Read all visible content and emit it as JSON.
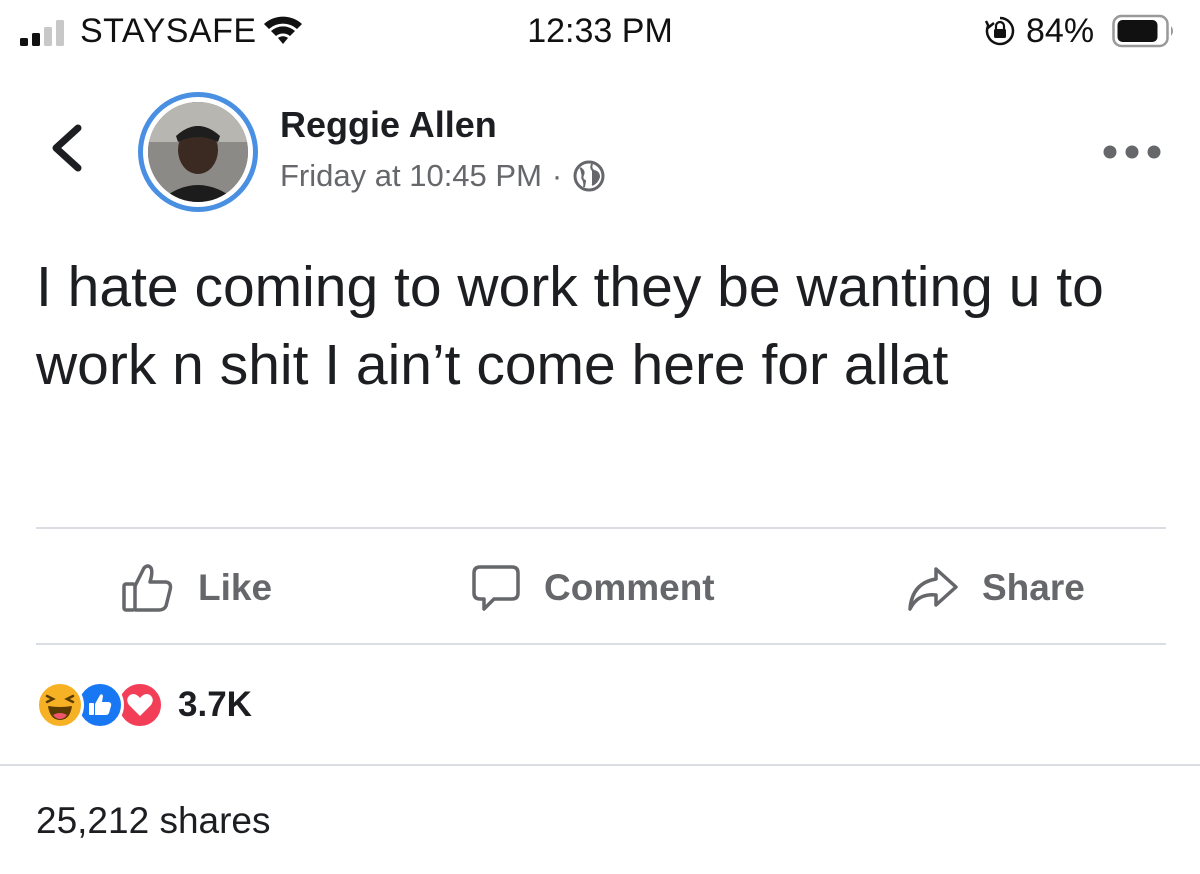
{
  "status_bar": {
    "carrier": "STAYSAFE",
    "time": "12:33 PM",
    "battery_percent": "84%",
    "icons": [
      "signal-icon",
      "wifi-icon",
      "rotation-lock-icon",
      "battery-icon"
    ]
  },
  "post": {
    "author": "Reggie Allen",
    "timestamp": "Friday at 10:45 PM",
    "separator": "·",
    "audience_icon": "globe-icon",
    "text": "I hate coming to work they be wanting u to work n shit I ain’t come here for allat"
  },
  "actions": {
    "like_label": "Like",
    "comment_label": "Comment",
    "share_label": "Share"
  },
  "reactions": {
    "types": [
      "haha",
      "like",
      "love"
    ],
    "count": "3.7K"
  },
  "shares": {
    "label": "25,212 shares"
  },
  "colors": {
    "accent_ring": "#4a90e2",
    "like_blue": "#1877f2",
    "love_red": "#f33e58",
    "haha_yellow": "#f7b125",
    "secondary_text": "#65676b"
  }
}
